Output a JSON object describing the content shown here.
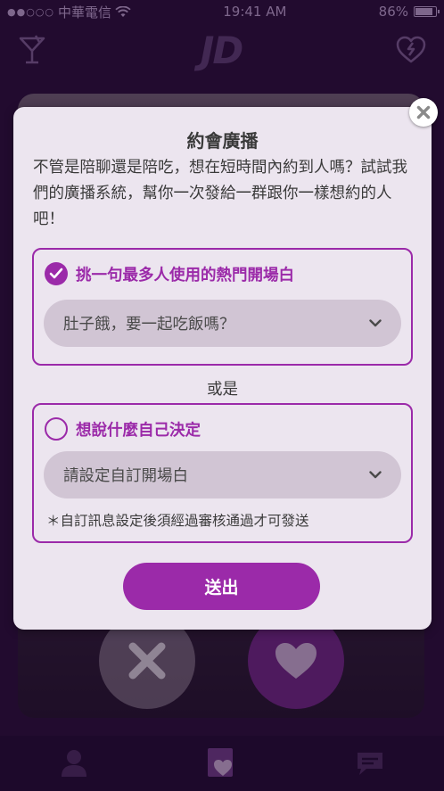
{
  "status_bar": {
    "carrier": "中華電信",
    "time": "19:41 AM",
    "battery": "86%"
  },
  "app": {
    "logo": "JD"
  },
  "modal": {
    "title": "約會廣播",
    "description": "不管是陪聊還是陪吃，想在短時間內約到人嗎？試試我們的廣播系統，幫你一次發給一群跟你一樣想約的人吧！",
    "option_popular": {
      "label": "挑一句最多人使用的熱門開場白",
      "selected": true,
      "value": "肚子餓，要一起吃飯嗎？"
    },
    "or_text": "或是",
    "option_custom": {
      "label": "想說什麼自己決定",
      "selected": false,
      "placeholder": "請設定自訂開場白",
      "note": "＊自訂訊息設定後須經過審核通過才可發送"
    },
    "send_label": "送出"
  },
  "colors": {
    "accent": "#9b2aa9",
    "modal_bg": "#ece5ef",
    "field_bg": "#d1c5d4",
    "app_bg": "#2a0f3a"
  },
  "icons": {
    "top_left": "cocktail-icon",
    "top_right": "broken-heart-icon",
    "close": "close-icon",
    "check": "checkmark-icon",
    "dropdown": "chevron-down-icon",
    "dislike": "x-icon",
    "like": "heart-icon",
    "nav_profile": "person-icon",
    "nav_cards": "heart-card-icon",
    "nav_chat": "chat-icon"
  }
}
